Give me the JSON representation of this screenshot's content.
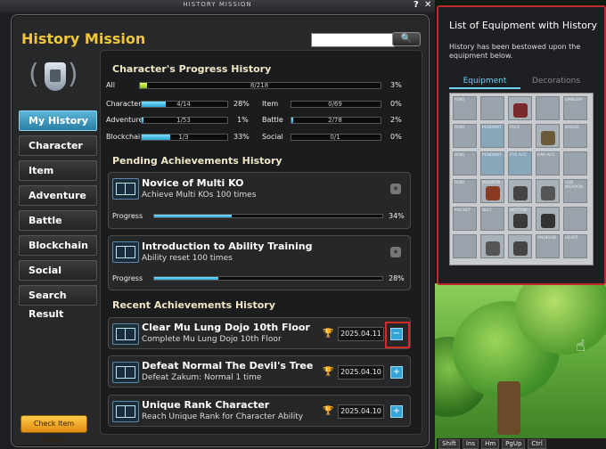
{
  "window": {
    "title": "HISTORY MISSION",
    "help": "?",
    "close": "✕"
  },
  "app": {
    "title": "History Mission",
    "search_placeholder": ""
  },
  "sidebar": {
    "items": [
      {
        "label": "My History",
        "active": true
      },
      {
        "label": "Character"
      },
      {
        "label": "Item"
      },
      {
        "label": "Adventure"
      },
      {
        "label": "Battle"
      },
      {
        "label": "Blockchain"
      },
      {
        "label": "Social"
      },
      {
        "label": "Search Result"
      }
    ],
    "check_item_history": "Check Item History"
  },
  "progress": {
    "title": "Character's Progress History",
    "all": {
      "label": "All",
      "value": "8/218",
      "pct": "3%",
      "fraction": 0.03
    },
    "rows": [
      {
        "label": "Character",
        "value": "4/14",
        "pct": "28%",
        "fraction": 0.28
      },
      {
        "label": "Item",
        "value": "0/69",
        "pct": "0%",
        "fraction": 0
      },
      {
        "label": "Adventure",
        "value": "1/53",
        "pct": "1%",
        "fraction": 0.02
      },
      {
        "label": "Battle",
        "value": "2/78",
        "pct": "2%",
        "fraction": 0.02
      },
      {
        "label": "Blockchain",
        "value": "1/3",
        "pct": "33%",
        "fraction": 0.33
      },
      {
        "label": "Social",
        "value": "0/1",
        "pct": "0%",
        "fraction": 0
      }
    ]
  },
  "pending": {
    "title": "Pending Achievements History",
    "items": [
      {
        "name": "Novice of Multi KO",
        "desc": "Achieve Multi KOs 100 times",
        "progress_label": "Progress",
        "pct": "34%",
        "fraction": 0.34
      },
      {
        "name": "Introduction to Ability Training",
        "desc": "Ability reset 100 times",
        "progress_label": "Progress",
        "pct": "28%",
        "fraction": 0.28
      }
    ]
  },
  "recent": {
    "title": "Recent Achievements History",
    "items": [
      {
        "name": "Clear Mu Lung Dojo 10th Floor",
        "desc": "Complete Mu Lung Dojo 10th Floor",
        "date": "2025.04.11",
        "toggle": "−"
      },
      {
        "name": "Defeat Normal The Devil's Tree",
        "desc": "Defeat Zakum: Normal 1 time",
        "date": "2025.04.10",
        "toggle": "+"
      },
      {
        "name": "Unique Rank Character",
        "desc": "Reach Unique Rank for Character Ability",
        "date": "2025.04.10",
        "toggle": "+"
      }
    ]
  },
  "equipment": {
    "title": "List of Equipment with History",
    "desc": "History has been bestowed upon the equipment below.",
    "tabs": [
      "Equipment",
      "Decorations"
    ],
    "slots": [
      "RING",
      "",
      "",
      "",
      "EMBLEM",
      "RING",
      "PENDANT",
      "FACE",
      "",
      "BADGE",
      "RING",
      "PENDANT",
      "EYE ACC",
      "EAR ACC",
      "",
      "RING",
      "WEAPON",
      "",
      "",
      "SUB WEAPON",
      "POCKET",
      "BELT",
      "BOTTOM",
      "",
      "",
      "",
      "",
      "",
      "ANDROID",
      "HEART"
    ]
  },
  "taskbar": [
    "Shift",
    "Ins",
    "Hm",
    "PgUp",
    "Ctrl"
  ]
}
